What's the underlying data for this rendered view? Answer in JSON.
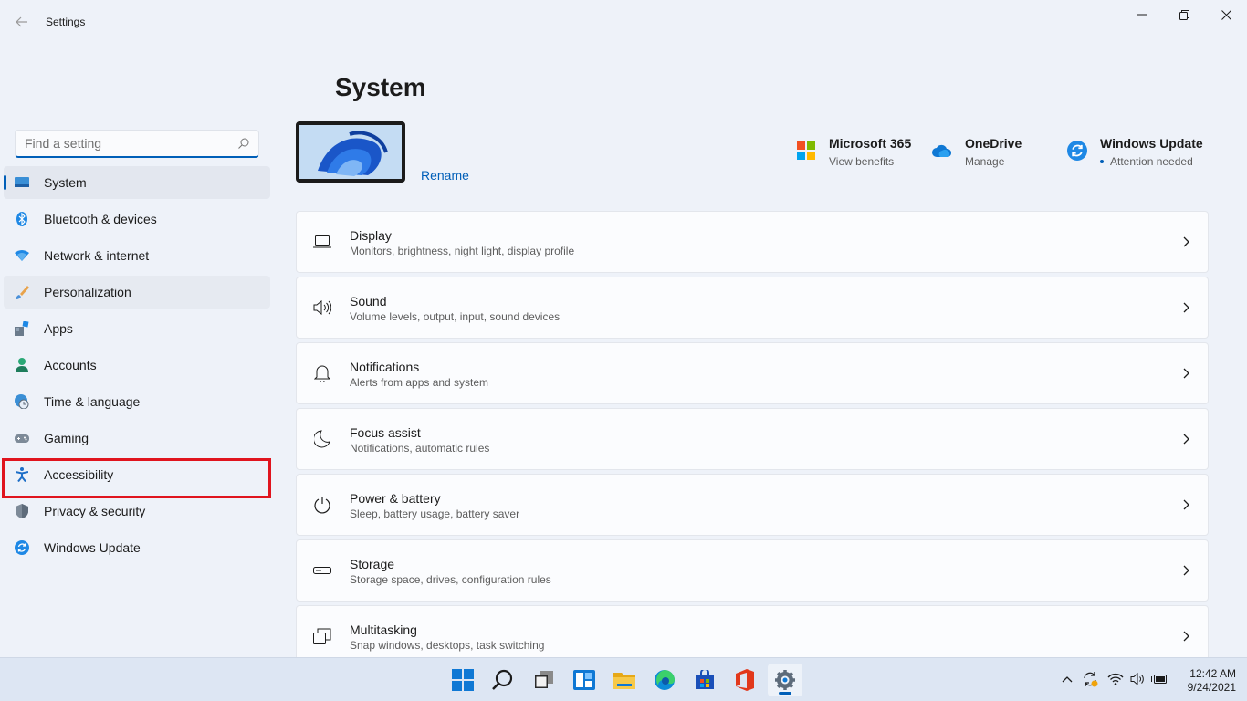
{
  "window": {
    "app_title": "Settings",
    "controls": [
      "minimize-icon",
      "maximize-icon",
      "close-icon"
    ]
  },
  "sidebar": {
    "search_placeholder": "Find a setting",
    "items": [
      {
        "label": "System",
        "icon": "monitor-icon",
        "selected": true
      },
      {
        "label": "Bluetooth & devices",
        "icon": "bluetooth-icon"
      },
      {
        "label": "Network & internet",
        "icon": "wifi-icon"
      },
      {
        "label": "Personalization",
        "icon": "brush-icon"
      },
      {
        "label": "Apps",
        "icon": "apps-icon"
      },
      {
        "label": "Accounts",
        "icon": "person-icon"
      },
      {
        "label": "Time & language",
        "icon": "globe-clock-icon"
      },
      {
        "label": "Gaming",
        "icon": "gamepad-icon"
      },
      {
        "label": "Accessibility",
        "icon": "accessibility-icon",
        "highlighted": true
      },
      {
        "label": "Privacy & security",
        "icon": "shield-icon"
      },
      {
        "label": "Windows Update",
        "icon": "update-icon"
      }
    ]
  },
  "main": {
    "title": "System",
    "rename_label": "Rename",
    "quick_links": [
      {
        "title": "Microsoft 365",
        "subtitle": "View benefits",
        "icon": "microsoft-logo-icon"
      },
      {
        "title": "OneDrive",
        "subtitle": "Manage",
        "icon": "cloud-icon"
      },
      {
        "title": "Windows Update",
        "subtitle": "Attention needed",
        "icon": "update-icon"
      }
    ],
    "cards": [
      {
        "title": "Display",
        "subtitle": "Monitors, brightness, night light, display profile",
        "icon": "display-icon"
      },
      {
        "title": "Sound",
        "subtitle": "Volume levels, output, input, sound devices",
        "icon": "speaker-icon"
      },
      {
        "title": "Notifications",
        "subtitle": "Alerts from apps and system",
        "icon": "bell-icon"
      },
      {
        "title": "Focus assist",
        "subtitle": "Notifications, automatic rules",
        "icon": "moon-icon"
      },
      {
        "title": "Power & battery",
        "subtitle": "Sleep, battery usage, battery saver",
        "icon": "power-icon"
      },
      {
        "title": "Storage",
        "subtitle": "Storage space, drives, configuration rules",
        "icon": "drive-icon"
      },
      {
        "title": "Multitasking",
        "subtitle": "Snap windows, desktops, task switching",
        "icon": "multitask-icon"
      }
    ]
  },
  "taskbar": {
    "apps": [
      "start-icon",
      "search-icon",
      "task-view-icon",
      "widgets-icon",
      "file-explorer-icon",
      "edge-icon",
      "store-icon",
      "office-icon",
      "settings-icon"
    ],
    "tray": [
      "chevron-up-icon",
      "sync-icon",
      "wifi-icon",
      "volume-icon",
      "battery-icon"
    ],
    "time": "12:42 AM",
    "date": "9/24/2021"
  },
  "colors": {
    "accent": "#005fb8",
    "highlight_box": "#e0141e"
  }
}
